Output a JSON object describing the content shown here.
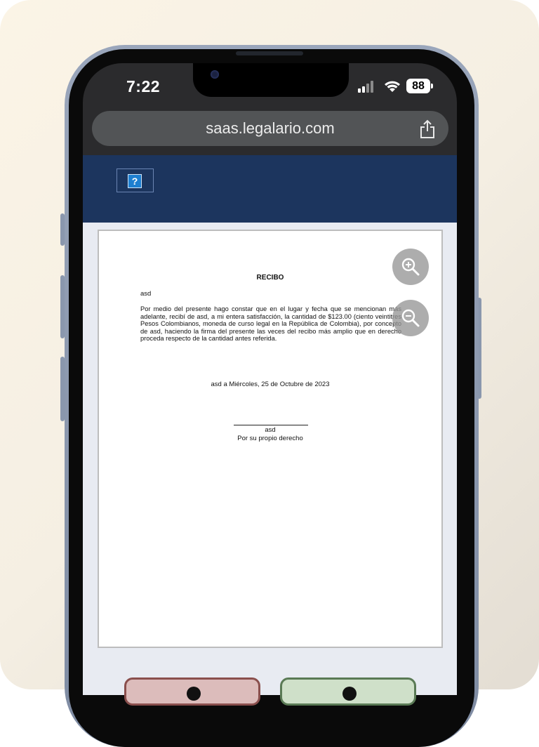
{
  "status_bar": {
    "time": "7:22",
    "battery": "88"
  },
  "browser": {
    "url": "saas.legalario.com"
  },
  "header": {
    "help_icon_text": "?"
  },
  "document": {
    "title": "RECIBO",
    "recipient": "asd",
    "body": "Por medio del presente hago constar que en el lugar y fecha que se mencionan más adelante, recibí de asd, a mi entera satisfacción, la cantidad de $123.00 (ciento veintitres Pesos Colombianos, moneda de curso legal en la República de Colombia), por concepto de asd, haciendo la firma del presente las veces del recibo más amplio que en derecho proceda respecto de la cantidad antes referida.",
    "place_date": "asd a Miércoles, 25 de Octubre de 2023",
    "signer_name": "asd",
    "signer_caption": "Por su propio derecho"
  },
  "colors": {
    "header_bg": "#1c355e",
    "reject_button": "#dcbcbb",
    "accept_button": "#cfe0c9"
  },
  "icons": [
    "zoom-in-icon",
    "zoom-out-icon",
    "share-icon",
    "help-icon",
    "wifi-icon",
    "cellular-signal-icon",
    "battery-icon"
  ]
}
